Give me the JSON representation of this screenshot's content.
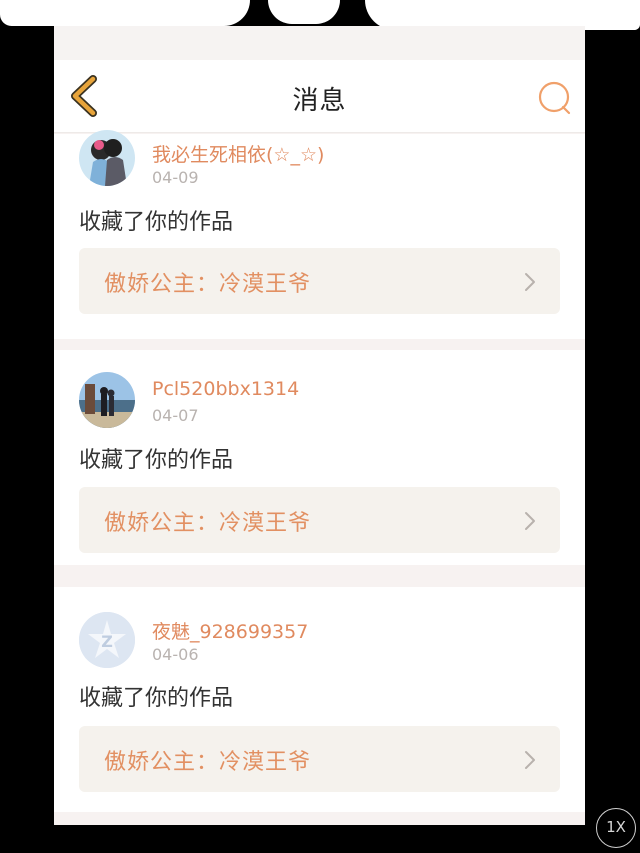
{
  "header": {
    "title": "消息",
    "back_icon": "chevron-left-icon",
    "search_icon": "search-icon",
    "accent_color": "#e8a43a"
  },
  "messages": [
    {
      "username": "我必生死相依(☆_☆)",
      "date": "04-09",
      "action": "收藏了你的作品",
      "work_title": "傲娇公主：冷漠王爷"
    },
    {
      "username": "Pcl520bbx1314",
      "date": "04-07",
      "action": "收藏了你的作品",
      "work_title": "傲娇公主：冷漠王爷"
    },
    {
      "username": "夜魅_928699357",
      "date": "04-06",
      "action": "收藏了你的作品",
      "work_title": "傲娇公主：冷漠王爷"
    }
  ],
  "player": {
    "zoom_label": "1X"
  },
  "colors": {
    "username": "#e08a5f",
    "work_title": "#e29062",
    "work_bg": "#f5f2ed",
    "page_bg": "#f7f2f1"
  }
}
